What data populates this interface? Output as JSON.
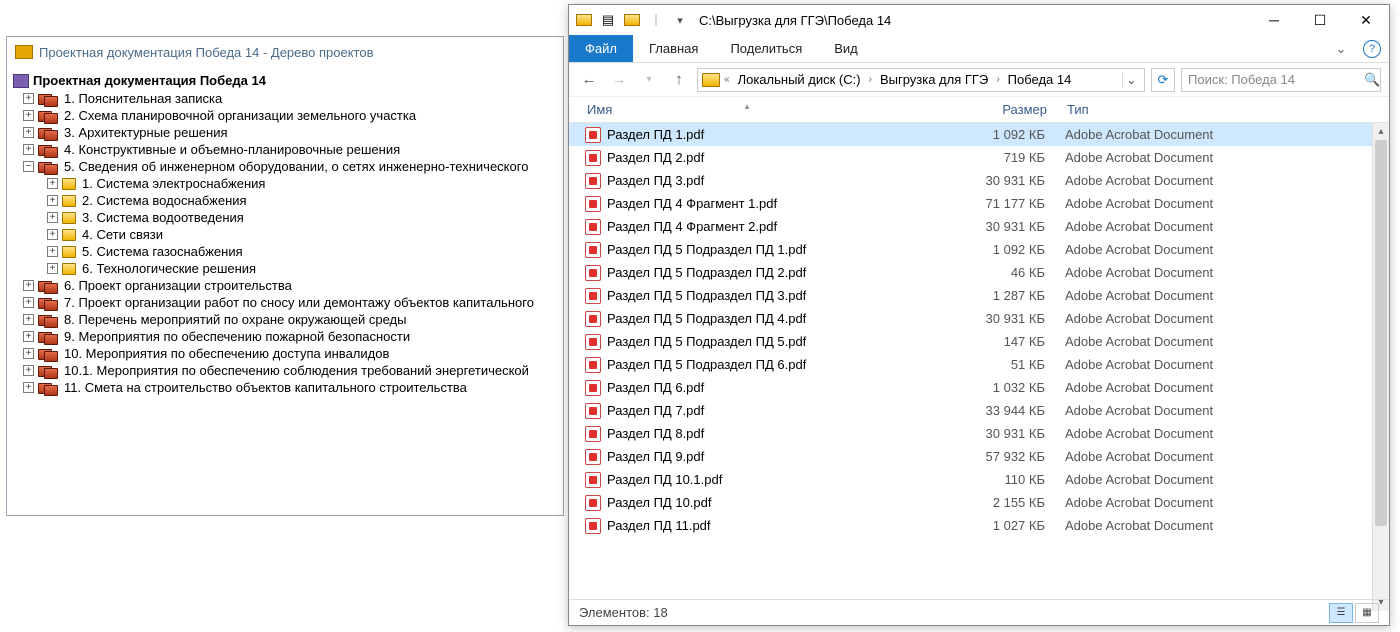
{
  "tree_window": {
    "title": "Проектная документация Победа 14 - Дерево проектов",
    "root": "Проектная документация Победа 14",
    "nodes": [
      {
        "lvl": 1,
        "tg": "+",
        "ic": "b",
        "label": "1. Пояснительная записка"
      },
      {
        "lvl": 1,
        "tg": "+",
        "ic": "b",
        "label": "2. Схема планировочной организации земельного участка"
      },
      {
        "lvl": 1,
        "tg": "+",
        "ic": "b",
        "label": "3. Архитектурные решения"
      },
      {
        "lvl": 1,
        "tg": "+",
        "ic": "b",
        "label": "4. Конструктивные и объемно-планировочные решения"
      },
      {
        "lvl": 1,
        "tg": "−",
        "ic": "b",
        "label": "5. Сведения об инженерном оборудовании, о сетях инженерно-технического"
      },
      {
        "lvl": 2,
        "tg": "+",
        "ic": "y",
        "label": "1. Система электроснабжения"
      },
      {
        "lvl": 2,
        "tg": "+",
        "ic": "y",
        "label": "2. Система водоснабжения"
      },
      {
        "lvl": 2,
        "tg": "+",
        "ic": "y",
        "label": "3. Система водоотведения"
      },
      {
        "lvl": 2,
        "tg": "+",
        "ic": "y",
        "label": "4. Сети связи"
      },
      {
        "lvl": 2,
        "tg": "+",
        "ic": "y",
        "label": "5. Система газоснабжения"
      },
      {
        "lvl": 2,
        "tg": "+",
        "ic": "y",
        "label": "6. Технологические решения"
      },
      {
        "lvl": 1,
        "tg": "+",
        "ic": "b",
        "label": "6. Проект организации строительства"
      },
      {
        "lvl": 1,
        "tg": "+",
        "ic": "b",
        "label": "7. Проект организации работ по сносу или демонтажу объектов капитального"
      },
      {
        "lvl": 1,
        "tg": "+",
        "ic": "b",
        "label": "8. Перечень мероприятий по охране окружающей среды"
      },
      {
        "lvl": 1,
        "tg": "+",
        "ic": "b",
        "label": "9. Мероприятия по обеспечению пожарной безопасности"
      },
      {
        "lvl": 1,
        "tg": "+",
        "ic": "b",
        "label": "10. Мероприятия по обеспечению доступа инвалидов"
      },
      {
        "lvl": 1,
        "tg": "+",
        "ic": "b",
        "label": "10.1. Мероприятия по обеспечению соблюдения требований энергетической"
      },
      {
        "lvl": 1,
        "tg": "+",
        "ic": "b",
        "label": "11. Смета на строительство объектов капитального строительства"
      }
    ]
  },
  "explorer": {
    "title_path": "C:\\Выгрузка для ГГЭ\\Победа 14",
    "ribbon": {
      "file": "Файл",
      "tabs": [
        "Главная",
        "Поделиться",
        "Вид"
      ]
    },
    "breadcrumb": {
      "segments": [
        "Локальный диск (C:)",
        "Выгрузка для ГГЭ",
        "Победа 14"
      ]
    },
    "search_placeholder": "Поиск: Победа 14",
    "columns": {
      "name": "Имя",
      "size": "Размер",
      "type": "Тип"
    },
    "type_label": "Adobe Acrobat Document",
    "files": [
      {
        "name": "Раздел ПД 1.pdf",
        "size": "1 092 КБ",
        "sel": true
      },
      {
        "name": "Раздел ПД 2.pdf",
        "size": "719 КБ"
      },
      {
        "name": "Раздел ПД 3.pdf",
        "size": "30 931 КБ"
      },
      {
        "name": "Раздел ПД 4 Фрагмент 1.pdf",
        "size": "71 177 КБ"
      },
      {
        "name": "Раздел ПД 4 Фрагмент 2.pdf",
        "size": "30 931 КБ"
      },
      {
        "name": "Раздел ПД 5 Подраздел ПД 1.pdf",
        "size": "1 092 КБ"
      },
      {
        "name": "Раздел ПД 5 Подраздел ПД 2.pdf",
        "size": "46 КБ"
      },
      {
        "name": "Раздел ПД 5 Подраздел ПД 3.pdf",
        "size": "1 287 КБ"
      },
      {
        "name": "Раздел ПД 5 Подраздел ПД 4.pdf",
        "size": "30 931 КБ"
      },
      {
        "name": "Раздел ПД 5 Подраздел ПД 5.pdf",
        "size": "147 КБ"
      },
      {
        "name": "Раздел ПД 5 Подраздел ПД 6.pdf",
        "size": "51 КБ"
      },
      {
        "name": "Раздел ПД 6.pdf",
        "size": "1 032 КБ"
      },
      {
        "name": "Раздел ПД 7.pdf",
        "size": "33 944 КБ"
      },
      {
        "name": "Раздел ПД 8.pdf",
        "size": "30 931 КБ"
      },
      {
        "name": "Раздел ПД 9.pdf",
        "size": "57 932 КБ"
      },
      {
        "name": "Раздел ПД 10.1.pdf",
        "size": "110 КБ"
      },
      {
        "name": "Раздел ПД 10.pdf",
        "size": "2 155 КБ"
      },
      {
        "name": "Раздел ПД 11.pdf",
        "size": "1 027 КБ"
      }
    ],
    "status": "Элементов: 18"
  }
}
